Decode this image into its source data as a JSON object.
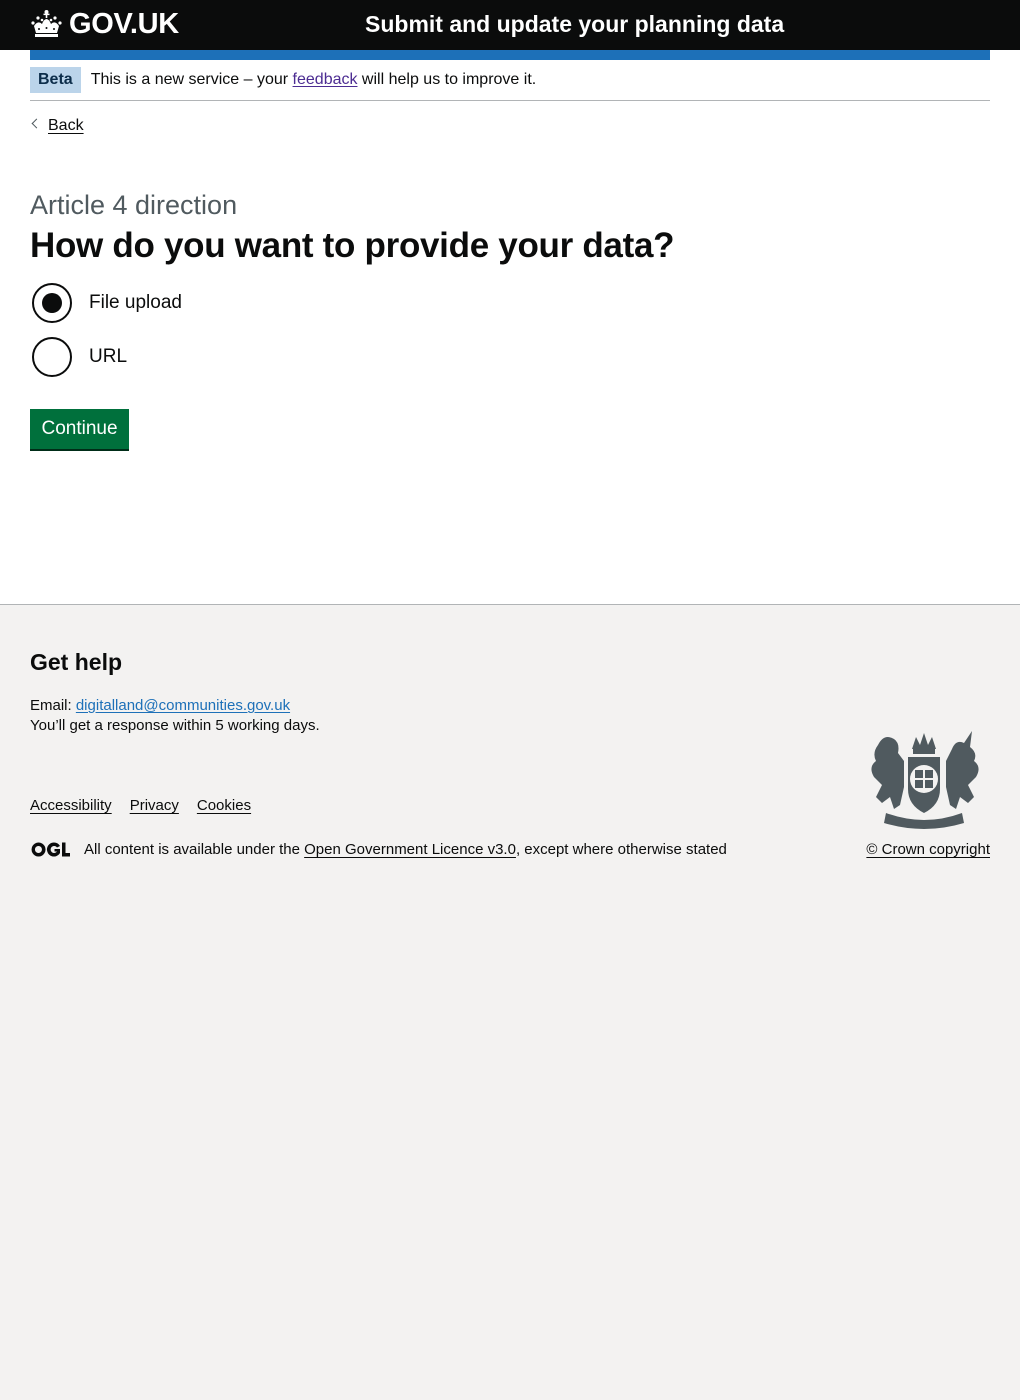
{
  "header": {
    "logo_text": "GOV.UK",
    "service_name": "Submit and update your planning data"
  },
  "phase_banner": {
    "tag": "Beta",
    "text_before": "This is a new service – your ",
    "link": "feedback",
    "text_after": " will help us to improve it."
  },
  "back_link": "Back",
  "form": {
    "caption": "Article 4 direction",
    "heading": "How do you want to provide your data?",
    "options": [
      {
        "label": "File upload",
        "checked": true
      },
      {
        "label": "URL",
        "checked": false
      }
    ],
    "continue_label": "Continue"
  },
  "footer": {
    "heading": "Get help",
    "email_label": "Email: ",
    "email": "digitalland@communities.gov.uk",
    "response_text": "You’ll get a response within 5 working days.",
    "links": [
      "Accessibility",
      "Privacy",
      "Cookies"
    ],
    "licence_before": "All content is available under the ",
    "licence_link": "Open Government Licence v3.0",
    "licence_after": ", except where otherwise stated",
    "copyright": "© Crown copyright"
  },
  "colors": {
    "header_bg": "#0b0c0c",
    "brand_blue": "#1d70b8",
    "button_green": "#00703c",
    "visited_link": "#4c2c92",
    "footer_bg": "#f3f2f1"
  }
}
